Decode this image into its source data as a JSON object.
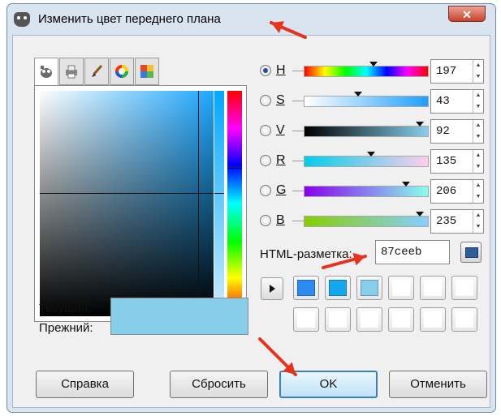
{
  "window": {
    "title": "Изменить цвет переднего плана",
    "close_label": "✕"
  },
  "selectors": [
    "gimp-icon",
    "printer-icon",
    "brush-icon",
    "color-wheel-icon",
    "palette-icon"
  ],
  "sliders": [
    {
      "label": "H",
      "value": "197",
      "checked": true,
      "gradient": "linear-gradient(to right,#ff0000,#ffff00,#00ff00,#00ffff,#0000ff,#ff00ff,#ff0000)",
      "level": 0.55
    },
    {
      "label": "S",
      "value": "43",
      "checked": false,
      "gradient": "linear-gradient(to right,#ffffff,#1ea0ff)",
      "level": 0.43
    },
    {
      "label": "V",
      "value": "92",
      "checked": false,
      "gradient": "linear-gradient(to right,#000000,#87ceeb)",
      "level": 0.92
    },
    {
      "label": "R",
      "value": "135",
      "checked": false,
      "gradient": "linear-gradient(to right,#00ceeb,#ffceeb)",
      "level": 0.53
    },
    {
      "label": "G",
      "value": "206",
      "checked": false,
      "gradient": "linear-gradient(to right,#8700eb,#87ffeb)",
      "level": 0.81
    },
    {
      "label": "B",
      "value": "235",
      "checked": false,
      "gradient": "linear-gradient(to right,#87ce00,#87ceff)",
      "level": 0.92
    }
  ],
  "html_notation": {
    "label": "HTML-разметка:",
    "value": "87ceeb"
  },
  "history": [
    "#2b8bf2",
    "#14a6ee",
    "#87ceeb",
    "#ffffff",
    "#ffffff",
    "#ffffff",
    "#ffffff",
    "#ffffff",
    "#ffffff",
    "#ffffff",
    "#ffffff",
    "#ffffff"
  ],
  "current": {
    "current_label": "Текущий:",
    "old_label": "Прежний:",
    "current_color": "#87ceeb",
    "old_color": "#87ceeb"
  },
  "buttons": {
    "help": "Справка",
    "reset": "Сбросить",
    "ok": "OK",
    "cancel": "Отменить"
  },
  "annotation_color": "#e8321e"
}
